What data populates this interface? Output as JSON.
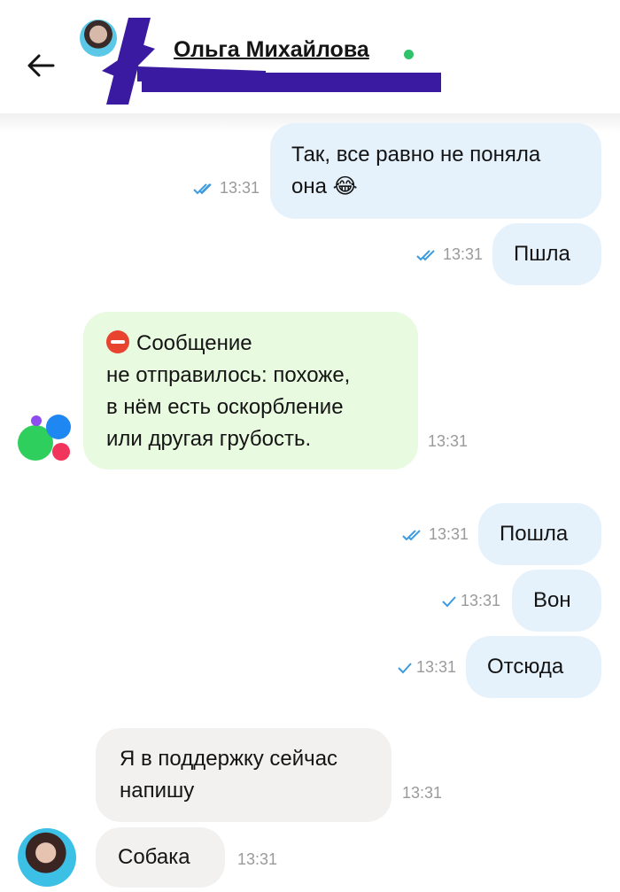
{
  "header": {
    "contact_name": "Ольга Михайлова",
    "back_icon": "arrow-left-icon",
    "online_color": "#2fc26b"
  },
  "messages": [
    {
      "type": "outgoing",
      "text_line1": "Так, все равно не поняла",
      "text_line2": "она 😂",
      "time": "13:31",
      "status": "read"
    },
    {
      "type": "outgoing",
      "text": "Пшла",
      "time": "13:31",
      "status": "read"
    },
    {
      "type": "system",
      "text_line1": "Сообщение",
      "text_line2": "не отправилось: похоже,",
      "text_line3": "в нём есть оскорбление",
      "text_line4": "или другая грубость.",
      "time": "13:31",
      "icon": "no-entry-icon"
    },
    {
      "type": "outgoing",
      "text": "Пошла",
      "time": "13:31",
      "status": "read"
    },
    {
      "type": "outgoing",
      "text": "Вон",
      "time": "13:31",
      "status": "sent"
    },
    {
      "type": "outgoing",
      "text": "Отсюда",
      "time": "13:31",
      "status": "sent"
    },
    {
      "type": "incoming",
      "text_line1": "Я в поддержку сейчас",
      "text_line2": "напишу",
      "time": "13:31"
    },
    {
      "type": "incoming",
      "text": "Собака",
      "time": "13:31"
    }
  ],
  "colors": {
    "outgoing_bubble": "#e6f2fb",
    "system_bubble": "#e8fadf",
    "incoming_bubble": "#f2f1f0",
    "tick": "#3d9be0",
    "redaction": "#3a1aa0"
  }
}
